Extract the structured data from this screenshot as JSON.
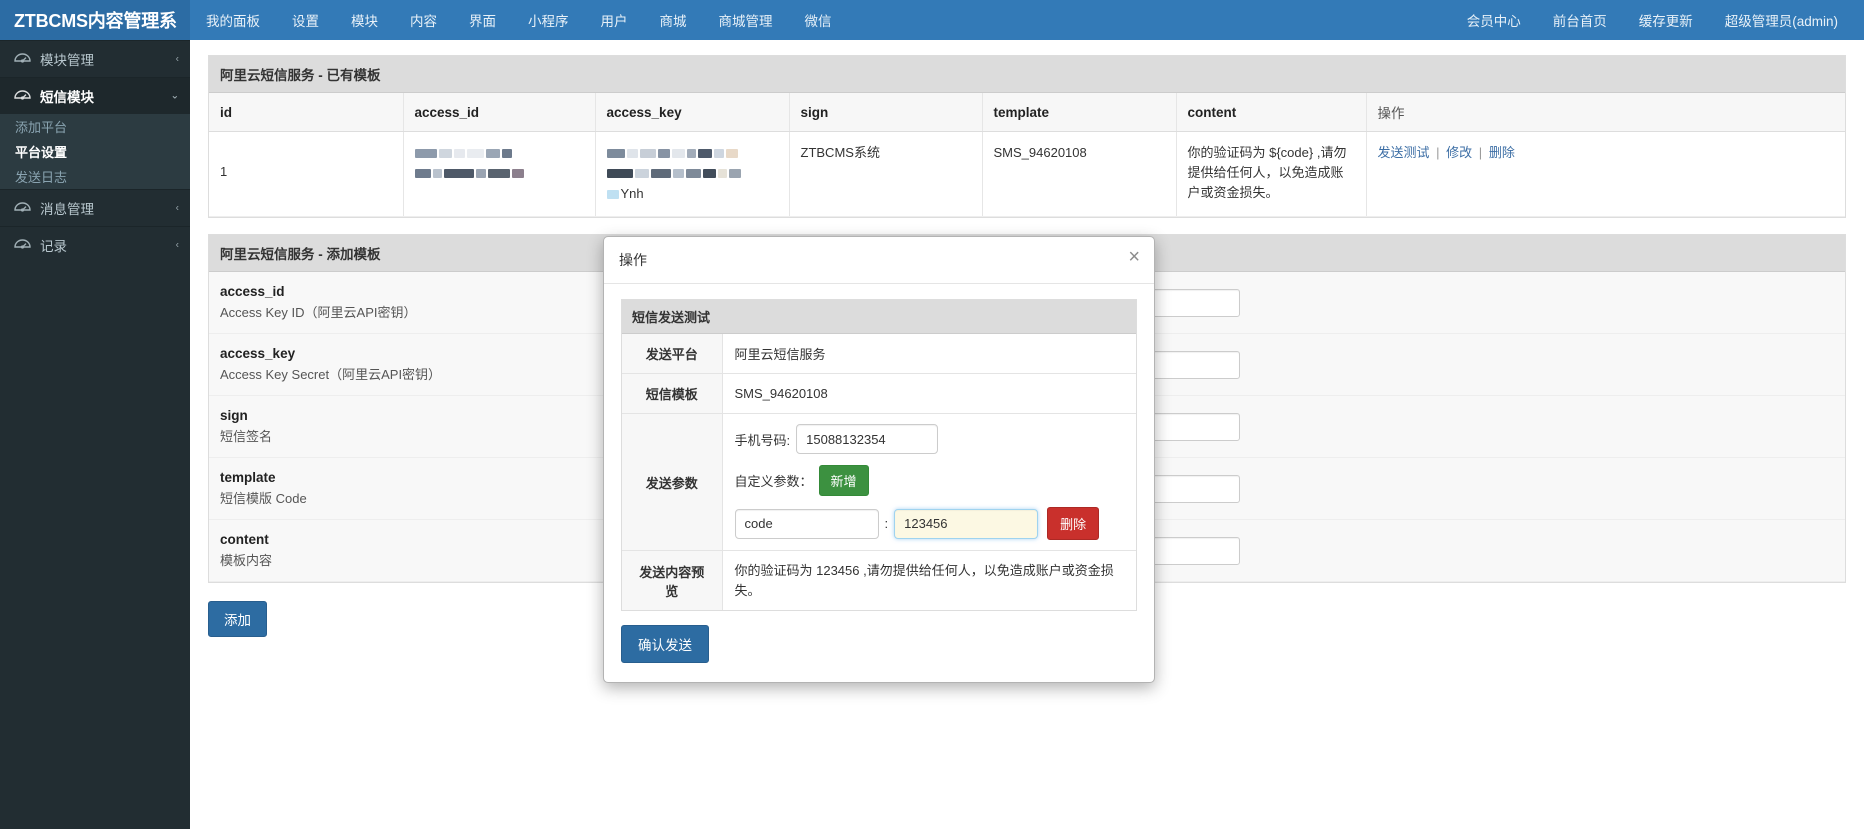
{
  "topbar": {
    "brand": "ZTBCMS内容管理系",
    "left_items": [
      {
        "label": "我的面板",
        "name": "nav-my-panel"
      },
      {
        "label": "设置",
        "name": "nav-settings"
      },
      {
        "label": "模块",
        "name": "nav-modules"
      },
      {
        "label": "内容",
        "name": "nav-content"
      },
      {
        "label": "界面",
        "name": "nav-interface"
      },
      {
        "label": "小程序",
        "name": "nav-miniprogram"
      },
      {
        "label": "用户",
        "name": "nav-users"
      },
      {
        "label": "商城",
        "name": "nav-shop"
      },
      {
        "label": "商城管理",
        "name": "nav-shop-admin"
      },
      {
        "label": "微信",
        "name": "nav-wechat"
      }
    ],
    "right_items": [
      {
        "label": "会员中心",
        "name": "nav-member-center"
      },
      {
        "label": "前台首页",
        "name": "nav-frontend-home"
      },
      {
        "label": "缓存更新",
        "name": "nav-cache-refresh"
      },
      {
        "label": "超级管理员(admin)",
        "name": "nav-account"
      }
    ]
  },
  "sidebar": {
    "items": [
      {
        "label": "模块管理",
        "icon": "dashboard-icon",
        "caret": "‹",
        "active": false
      },
      {
        "label": "短信模块",
        "icon": "dashboard-icon",
        "caret": "⌄",
        "active": true
      },
      {
        "label": "消息管理",
        "icon": "dashboard-icon",
        "caret": "‹",
        "active": false
      },
      {
        "label": "记录",
        "icon": "dashboard-icon",
        "caret": "‹",
        "active": false
      }
    ],
    "submenu": [
      {
        "label": "添加平台",
        "active": false
      },
      {
        "label": "平台设置",
        "active": true
      },
      {
        "label": "发送日志",
        "active": false
      }
    ]
  },
  "existing_panel": {
    "title": "阿里云短信服务 - 已有模板",
    "columns": [
      "id",
      "access_id",
      "access_key",
      "sign",
      "template",
      "content",
      "操作"
    ],
    "rows": [
      {
        "id": "1",
        "access_id": "",
        "access_key": "Ynh",
        "sign": "ZTBCMS系统",
        "template": "SMS_94620108",
        "content": "你的验证码为 ${code} ,请勿提供给任何人，以免造成账户或资金损失。",
        "actions": [
          "发送测试",
          "修改",
          "删除"
        ],
        "action_separator": "|"
      }
    ]
  },
  "add_panel": {
    "title": "阿里云短信服务 - 添加模板",
    "fields": [
      {
        "name": "access_id",
        "desc": "Access Key ID（阿里云API密钥）",
        "value": "",
        "placeholder": ""
      },
      {
        "name": "access_key",
        "desc": "Access Key Secret（阿里云API密钥）",
        "value": "",
        "placeholder": ""
      },
      {
        "name": "sign",
        "desc": "短信签名",
        "value": "",
        "placeholder": ""
      },
      {
        "name": "template",
        "desc": "短信模版 Code",
        "value": "",
        "placeholder": ""
      },
      {
        "name": "content",
        "desc": "模板内容",
        "value": "",
        "placeholder": ""
      }
    ],
    "submit_label": "添加"
  },
  "modal": {
    "title": "操作",
    "close_icon": "×",
    "section_title": "短信发送测试",
    "rows": [
      {
        "label": "发送平台",
        "value": "阿里云短信服务"
      },
      {
        "label": "短信模板",
        "value": "SMS_94620108"
      }
    ],
    "params": {
      "label": "发送参数",
      "phone_label": "手机号码:",
      "phone_value": "15088132354",
      "phone_placeholder": "",
      "custom_label": "自定义参数：",
      "add_button": "新增",
      "param_key": "code",
      "param_key_placeholder": "",
      "param_colon": ":",
      "param_value": "123456",
      "param_value_placeholder": "",
      "delete_button": "删除"
    },
    "preview": {
      "label": "发送内容预览",
      "value": "你的验证码为 123456 ,请勿提供给任何人，以免造成账户或资金损失。"
    },
    "confirm_button": "确认发送"
  },
  "colors": {
    "navbar": "#337ab7",
    "sidebar": "#222d32",
    "primary": "#2d6ca2",
    "success": "#3c9140",
    "danger": "#c9302c",
    "link": "#3c6ea5",
    "highlight_field": "#fcf8e3"
  }
}
